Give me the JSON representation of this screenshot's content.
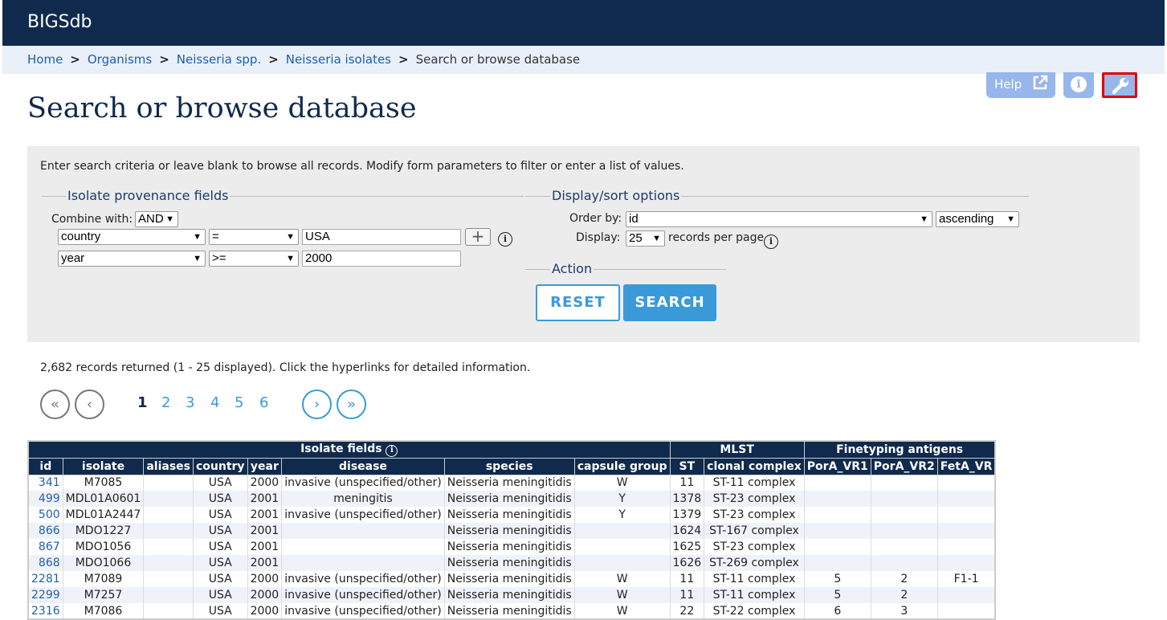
{
  "app": {
    "brand": "BIGSdb"
  },
  "breadcrumb": [
    {
      "label": "Home"
    },
    {
      "label": "Organisms"
    },
    {
      "label": "Neisseria spp."
    },
    {
      "label": "Neisseria isolates"
    }
  ],
  "breadcrumb_current": "Search or browse database",
  "toolbar": {
    "help_label": "Help",
    "help_icon": "external-link-icon",
    "info_icon": "info-icon",
    "settings_icon": "wrench-icon"
  },
  "page_title": "Search or browse database",
  "intro": "Enter search criteria or leave blank to browse all records. Modify form parameters to filter or enter a list of values.",
  "provenance": {
    "legend": "Isolate provenance fields",
    "combine_label": "Combine with:",
    "combine_value": "AND",
    "row1": {
      "field": "country",
      "operator": "=",
      "value": "USA"
    },
    "row2": {
      "field": "year",
      "operator": ">=",
      "value": "2000"
    },
    "add_label": "+"
  },
  "display": {
    "legend": "Display/sort options",
    "order_label": "Order by:",
    "order_value": "id",
    "direction_value": "ascending",
    "display_label": "Display:",
    "display_value": "25",
    "per_page_label": "records per page"
  },
  "action": {
    "legend": "Action",
    "reset_label": "RESET",
    "search_label": "SEARCH"
  },
  "results": {
    "summary": "2,682 records returned (1 - 25 displayed). Click the hyperlinks for detailed information.",
    "pages": [
      "1",
      "2",
      "3",
      "4",
      "5",
      "6"
    ],
    "current_page": "1",
    "pager": {
      "first": "«",
      "prev": "‹",
      "next": "›",
      "last": "»"
    }
  },
  "table": {
    "group_headers": [
      "Isolate fields",
      "MLST",
      "Finetyping antigens"
    ],
    "columns": [
      "id",
      "isolate",
      "aliases",
      "country",
      "year",
      "disease",
      "species",
      "capsule group",
      "ST",
      "clonal complex",
      "PorA_VR1",
      "PorA_VR2",
      "FetA_VR"
    ],
    "rows": [
      [
        "341",
        "M7085",
        "",
        "USA",
        "2000",
        "invasive (unspecified/other)",
        "Neisseria meningitidis",
        "W",
        "11",
        "ST-11 complex",
        "",
        "",
        ""
      ],
      [
        "499",
        "MDL01A0601",
        "",
        "USA",
        "2001",
        "meningitis",
        "Neisseria meningitidis",
        "Y",
        "1378",
        "ST-23 complex",
        "",
        "",
        ""
      ],
      [
        "500",
        "MDL01A2447",
        "",
        "USA",
        "2001",
        "invasive (unspecified/other)",
        "Neisseria meningitidis",
        "Y",
        "1379",
        "ST-23 complex",
        "",
        "",
        ""
      ],
      [
        "866",
        "MDO1227",
        "",
        "USA",
        "2001",
        "",
        "Neisseria meningitidis",
        "",
        "1624",
        "ST-167 complex",
        "",
        "",
        ""
      ],
      [
        "867",
        "MDO1056",
        "",
        "USA",
        "2001",
        "",
        "Neisseria meningitidis",
        "",
        "1625",
        "ST-23 complex",
        "",
        "",
        ""
      ],
      [
        "868",
        "MDO1066",
        "",
        "USA",
        "2001",
        "",
        "Neisseria meningitidis",
        "",
        "1626",
        "ST-269 complex",
        "",
        "",
        ""
      ],
      [
        "2281",
        "M7089",
        "",
        "USA",
        "2000",
        "invasive (unspecified/other)",
        "Neisseria meningitidis",
        "W",
        "11",
        "ST-11 complex",
        "5",
        "2",
        "F1-1"
      ],
      [
        "2299",
        "M7257",
        "",
        "USA",
        "2000",
        "invasive (unspecified/other)",
        "Neisseria meningitidis",
        "W",
        "11",
        "ST-11 complex",
        "5",
        "2",
        ""
      ],
      [
        "2316",
        "M7086",
        "",
        "USA",
        "2000",
        "invasive (unspecified/other)",
        "Neisseria meningitidis",
        "W",
        "22",
        "ST-22 complex",
        "6",
        "3",
        ""
      ]
    ]
  }
}
